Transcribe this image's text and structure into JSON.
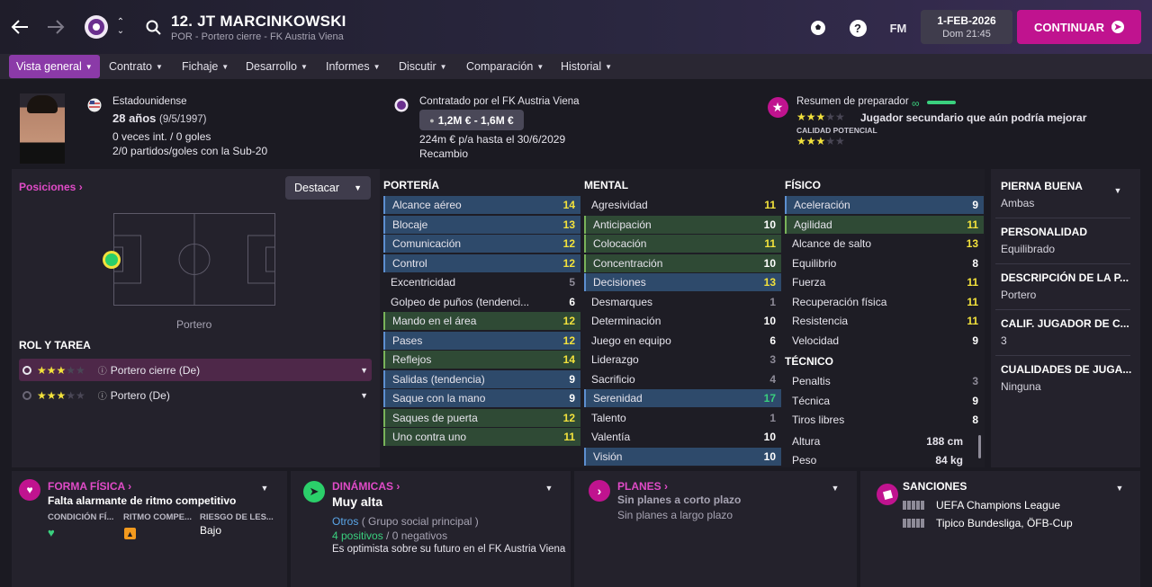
{
  "header": {
    "player_title": "12. JT MARCINKOWSKI",
    "player_subtitle": "POR - Portero cierre - FK Austria Viena",
    "fm_label": "FM",
    "date": "1-FEB-2026",
    "day_time": "Dom 21:45",
    "continue_label": "CONTINUAR"
  },
  "nav": {
    "items": [
      "Vista general",
      "Contrato",
      "Fichaje",
      "Desarrollo",
      "Informes",
      "Discutir",
      "Comparación",
      "Historial"
    ]
  },
  "profile": {
    "nationality": "Estadounidense",
    "age": "28 años",
    "birth": "(9/5/1997)",
    "caps": "0 veces int. / 0 goles",
    "u20": "2/0 partidos/goles con la Sub-20",
    "contract_by": "Contratado por el FK Austria Viena",
    "value": "1,2M € - 1,6M €",
    "wage": "224m € p/a hasta el 30/6/2029",
    "role_status": "Recambio",
    "coach_summary": "Resumen de preparador",
    "coach_desc": "Jugador secundario que aún podría mejorar",
    "potential_label": "CALIDAD POTENCIAL",
    "current_stars": 3,
    "potential_stars": 3
  },
  "positions": {
    "title": "Posiciones",
    "highlight_label": "Destacar",
    "pitch_caption": "Portero",
    "role_title": "ROL Y TAREA",
    "roles": [
      {
        "name": "Portero cierre (De)",
        "stars": 3
      },
      {
        "name": "Portero (De)",
        "stars": 3
      }
    ]
  },
  "attributes": {
    "porteria_title": "PORTERÍA",
    "porteria": [
      {
        "n": "Alcance aéreo",
        "v": "14",
        "h": "blue",
        "c": "yel"
      },
      {
        "n": "Blocaje",
        "v": "13",
        "h": "blue",
        "c": "yel"
      },
      {
        "n": "Comunicación",
        "v": "12",
        "h": "blue",
        "c": "yel"
      },
      {
        "n": "Control",
        "v": "12",
        "h": "blue",
        "c": "yel"
      },
      {
        "n": "Excentricidad",
        "v": "5",
        "h": "none",
        "c": "gry"
      },
      {
        "n": "Golpeo de puños (tendenci...",
        "v": "6",
        "h": "none",
        "c": "wht"
      },
      {
        "n": "Mando en el área",
        "v": "12",
        "h": "green",
        "c": "yel"
      },
      {
        "n": "Pases",
        "v": "12",
        "h": "blue",
        "c": "yel"
      },
      {
        "n": "Reflejos",
        "v": "14",
        "h": "green",
        "c": "yel"
      },
      {
        "n": "Salidas (tendencia)",
        "v": "9",
        "h": "blue",
        "c": "wht"
      },
      {
        "n": "Saque con la mano",
        "v": "9",
        "h": "blue",
        "c": "wht"
      },
      {
        "n": "Saques de puerta",
        "v": "12",
        "h": "green",
        "c": "yel"
      },
      {
        "n": "Uno contra uno",
        "v": "11",
        "h": "green",
        "c": "yel"
      }
    ],
    "mental_title": "MENTAL",
    "mental": [
      {
        "n": "Agresividad",
        "v": "11",
        "h": "none",
        "c": "yel"
      },
      {
        "n": "Anticipación",
        "v": "10",
        "h": "green",
        "c": "wht"
      },
      {
        "n": "Colocación",
        "v": "11",
        "h": "green",
        "c": "yel"
      },
      {
        "n": "Concentración",
        "v": "10",
        "h": "green",
        "c": "wht"
      },
      {
        "n": "Decisiones",
        "v": "13",
        "h": "blue",
        "c": "yel"
      },
      {
        "n": "Desmarques",
        "v": "1",
        "h": "none",
        "c": "gry"
      },
      {
        "n": "Determinación",
        "v": "10",
        "h": "none",
        "c": "wht"
      },
      {
        "n": "Juego en equipo",
        "v": "6",
        "h": "none",
        "c": "wht"
      },
      {
        "n": "Liderazgo",
        "v": "3",
        "h": "none",
        "c": "gry"
      },
      {
        "n": "Sacrificio",
        "v": "4",
        "h": "none",
        "c": "gry"
      },
      {
        "n": "Serenidad",
        "v": "17",
        "h": "blue",
        "c": "grn"
      },
      {
        "n": "Talento",
        "v": "1",
        "h": "none",
        "c": "gry"
      },
      {
        "n": "Valentía",
        "v": "10",
        "h": "none",
        "c": "wht"
      },
      {
        "n": "Visión",
        "v": "10",
        "h": "blue",
        "c": "wht"
      }
    ],
    "fisico_title": "FÍSICO",
    "fisico": [
      {
        "n": "Aceleración",
        "v": "9",
        "h": "blue",
        "c": "wht"
      },
      {
        "n": "Agilidad",
        "v": "11",
        "h": "green",
        "c": "yel"
      },
      {
        "n": "Alcance de salto",
        "v": "13",
        "h": "none",
        "c": "yel"
      },
      {
        "n": "Equilibrio",
        "v": "8",
        "h": "none",
        "c": "wht"
      },
      {
        "n": "Fuerza",
        "v": "11",
        "h": "none",
        "c": "yel"
      },
      {
        "n": "Recuperación física",
        "v": "11",
        "h": "none",
        "c": "yel"
      },
      {
        "n": "Resistencia",
        "v": "11",
        "h": "none",
        "c": "yel"
      },
      {
        "n": "Velocidad",
        "v": "9",
        "h": "none",
        "c": "wht"
      }
    ],
    "tecnico_title": "TÉCNICO",
    "tecnico": [
      {
        "n": "Penaltis",
        "v": "3",
        "h": "none",
        "c": "gry"
      },
      {
        "n": "Técnica",
        "v": "9",
        "h": "none",
        "c": "wht"
      },
      {
        "n": "Tiros libres",
        "v": "8",
        "h": "none",
        "c": "wht"
      }
    ],
    "height_label": "Altura",
    "height": "188 cm",
    "weight_label": "Peso",
    "weight": "84 kg"
  },
  "side": [
    {
      "k": "PIERNA BUENA",
      "v": "Ambas"
    },
    {
      "k": "PERSONALIDAD",
      "v": "Equilibrado"
    },
    {
      "k": "DESCRIPCIÓN DE LA P...",
      "v": "Portero"
    },
    {
      "k": "CALIF. JUGADOR DE C...",
      "v": "3"
    },
    {
      "k": "CUALIDADES DE JUGA...",
      "v": "Ninguna"
    }
  ],
  "bottom": {
    "forma_title": "FORMA FÍSICA",
    "forma_text": "Falta alarmante de ritmo competitivo",
    "forma_cols": [
      "CONDICIÓN FÍ...",
      "RITMO COMPE...",
      "RIESGO DE LES..."
    ],
    "riesgo": "Bajo",
    "din_title": "DINÁMICAS",
    "din_value": "Muy alta",
    "din_group": "Otros",
    "din_group_suffix": "( Grupo social principal )",
    "din_pos": "4 positivos",
    "din_neg": "0 negativos",
    "din_text": "Es optimista sobre su futuro en el FK Austria Viena",
    "planes_title": "PLANES",
    "planes_1": "Sin planes a corto plazo",
    "planes_2": "Sin planes a largo plazo",
    "sanc_title": "SANCIONES",
    "sanc_1": "UEFA Champions League",
    "sanc_2": "Tipico Bundesliga, ÖFB-Cup"
  },
  "colors": {
    "accent": "#c0138f",
    "highlight_blue": "#2e4a6b",
    "highlight_green": "#2f4a35",
    "star": "#f3e23c"
  }
}
